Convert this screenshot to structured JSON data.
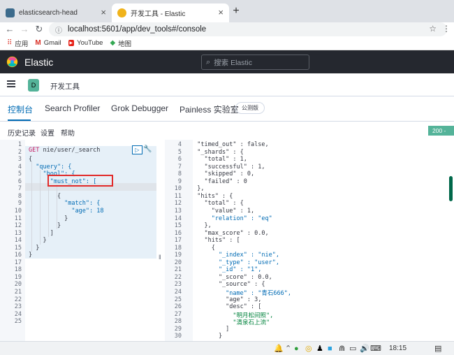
{
  "browser": {
    "tabs": [
      {
        "title": "elasticsearch-head",
        "close": "×",
        "favicon_color": "#3c6b8c"
      },
      {
        "title": "开发工具 - Elastic",
        "close": "×",
        "favicon_color": "#f0b31b"
      }
    ],
    "new_tab": "+",
    "url": "localhost:5601/app/dev_tools#/console",
    "bookmarks": [
      {
        "label": "应用",
        "icon": "apps-grid-icon"
      },
      {
        "label": "Gmail",
        "icon": "gmail-icon"
      },
      {
        "label": "YouTube",
        "icon": "youtube-icon"
      },
      {
        "label": "地图",
        "icon": "maps-icon"
      }
    ]
  },
  "kibana": {
    "title": "Elastic",
    "search_placeholder": "搜索 Elastic",
    "space_badge": "D",
    "breadcrumb": "开发工具",
    "tabs": [
      "控制台",
      "Search Profiler",
      "Grok Debugger",
      "Painless 实验室"
    ],
    "beta_badge": "公测版",
    "toolbar": [
      "历史记录",
      "设置",
      "帮助"
    ],
    "status": "200 - OK",
    "divider_glyph": "‖"
  },
  "request": {
    "line_numbers": [
      "1",
      "2",
      "3",
      "4",
      "5",
      "6",
      "7",
      "8",
      "9",
      "10",
      "11",
      "12",
      "13",
      "14",
      "15",
      "16",
      "17",
      "18",
      "19",
      "20",
      "21",
      "22",
      "23",
      "24",
      "25"
    ],
    "method": "GET",
    "path": "nie/user/_search",
    "lines": [
      "{",
      "  \"query\": {",
      "    \"bool\": {",
      "      \"must_not\": [",
      "",
      "        {",
      "          \"match\": {",
      "            \"age\": 18",
      "          }",
      "        }",
      "      ]",
      "    }",
      "  }",
      "}"
    ]
  },
  "response": {
    "line_numbers": [
      "4",
      "5",
      "6",
      "7",
      "8",
      "9",
      "10",
      "11",
      "12",
      "13",
      "14",
      "15",
      "16",
      "17",
      "18",
      "19",
      "20",
      "21",
      "22",
      "23",
      "24",
      "25",
      "26",
      "27",
      "28",
      "29",
      "30"
    ],
    "lines": [
      "  \"timed_out\" : false,",
      "  \"_shards\" : {",
      "    \"total\" : 1,",
      "    \"successful\" : 1,",
      "    \"skipped\" : 0,",
      "    \"failed\" : 0",
      "  },",
      "  \"hits\" : {",
      "    \"total\" : {",
      "      \"value\" : 1,",
      "      \"relation\" : \"eq\"",
      "    },",
      "    \"max_score\" : 0.0,",
      "    \"hits\" : [",
      "      {",
      "        \"_index\" : \"nie\",",
      "        \"_type\" : \"user\",",
      "        \"_id\" : \"1\",",
      "        \"_score\" : 0.0,",
      "        \"_source\" : {",
      "          \"name\" : \"青石666\",",
      "          \"age\" : 3,",
      "          \"desc\" : [",
      "            \"明月松间照\",",
      "            \"清泉石上流\"",
      "          ]",
      "        }"
    ]
  },
  "taskbar": {
    "time": "18:15"
  }
}
